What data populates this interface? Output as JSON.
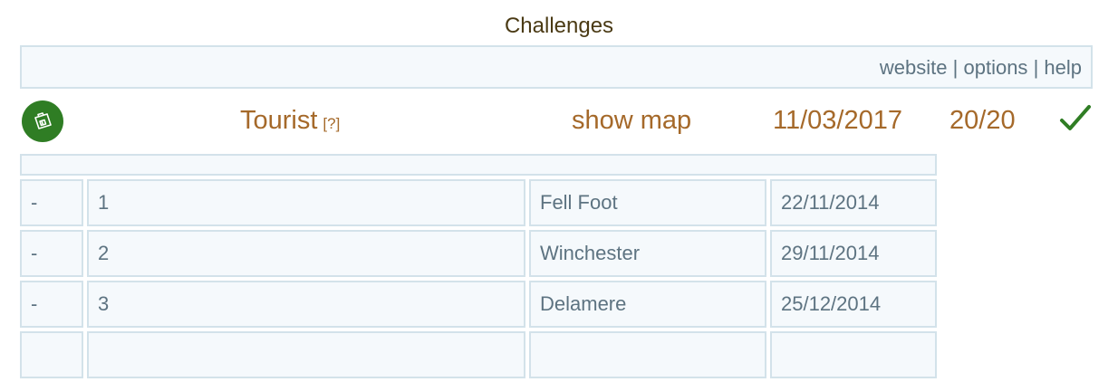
{
  "page": {
    "title": "Challenges"
  },
  "toolbar": {
    "links": [
      "website",
      "options",
      "help"
    ],
    "separator": "|"
  },
  "challenge": {
    "icon": "suitcase-icon",
    "name": "Tourist",
    "help_label": "[?]",
    "map_label": "show map",
    "date": "11/03/2017",
    "score": "20/20",
    "completed_icon": "checkmark-icon",
    "badge_color": "#2f7d24",
    "check_color": "#2f7d24",
    "accent_color": "#a5692a"
  },
  "events": [
    {
      "marker": "-",
      "number": "1",
      "place": "Fell Foot",
      "date": "22/11/2014"
    },
    {
      "marker": "-",
      "number": "2",
      "place": "Winchester",
      "date": "29/11/2014"
    },
    {
      "marker": "-",
      "number": "3",
      "place": "Delamere",
      "date": "25/12/2014"
    }
  ]
}
